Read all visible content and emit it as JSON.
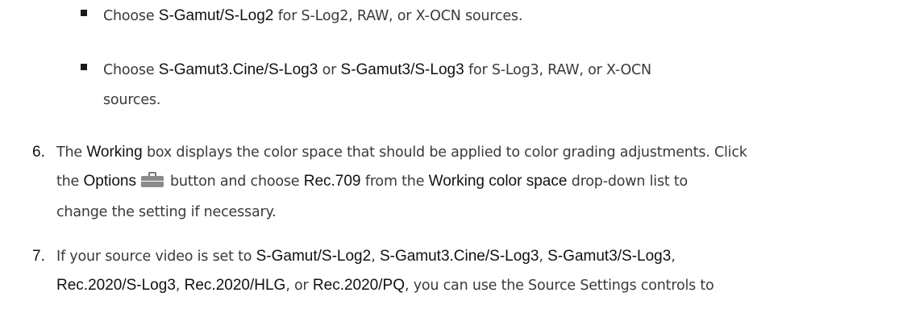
{
  "bullets": [
    {
      "line1": {
        "t1": "Choose ",
        "b1": "S-Gamut/S-Log2",
        "t2": " for S-Log2, RAW, or X-OCN sources."
      }
    },
    {
      "line1": {
        "t1": "Choose ",
        "b1": "S-Gamut3.Cine/S-Log3",
        "t2": " or ",
        "b2": "S-Gamut3/S-Log3",
        "t3": " for S-Log3, RAW, or X-OCN"
      },
      "line2": "sources."
    }
  ],
  "steps": [
    {
      "number": "6.",
      "line1": {
        "t1": "The ",
        "b1": "Working",
        "t2": " box displays the color space that should be applied to color grading adjustments. Click"
      },
      "line2": {
        "t1": "the ",
        "b1": "Options",
        "icon": "toolbox-icon",
        "t2": "button and choose ",
        "b2": "Rec.709",
        "t3": " from the ",
        "b3": "Working color space",
        "t4": " drop-down list to"
      },
      "line3": "change the setting if necessary."
    },
    {
      "number": "7.",
      "line1": {
        "t1": "If your source video is set to ",
        "b1": "S-Gamut/S-Log2",
        "t2": ", ",
        "b2": "S-Gamut3.Cine/S-Log3",
        "t3": ", ",
        "b3": "S-Gamut3/S-Log3",
        "t4": ","
      },
      "line2": {
        "b1": "Rec.2020/S-Log3",
        "t1": ", ",
        "b2": "Rec.2020/HLG",
        "t2": ", or ",
        "b3": "Rec.2020/PQ",
        "t3": ", you can use the Source Settings controls to"
      }
    }
  ]
}
